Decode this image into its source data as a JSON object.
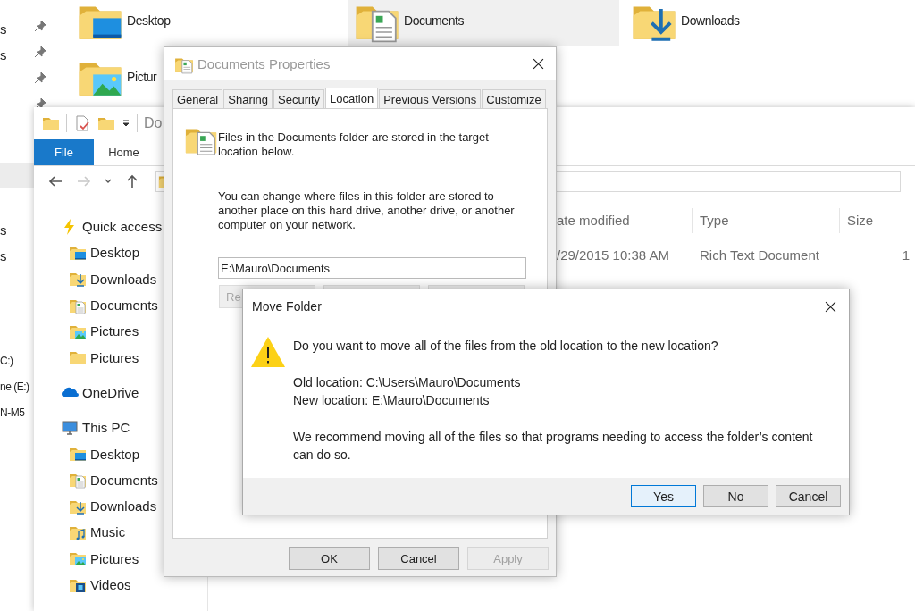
{
  "background_window": {
    "nav_groups": [
      [
        "s",
        "s"
      ],
      [
        "s",
        "s"
      ],
      [
        "C:)",
        "ne (E:)",
        "N-M5"
      ]
    ],
    "tiles": [
      {
        "label": "Desktop",
        "kind": "desktop",
        "selected": false
      },
      {
        "label": "Documents",
        "kind": "documents",
        "selected": true
      },
      {
        "label": "Downloads",
        "kind": "downloads",
        "selected": false
      },
      {
        "label": "Pictur",
        "kind": "pictures",
        "selected": false
      }
    ]
  },
  "explorer": {
    "title_fragment": "Do",
    "ribbon_tabs": [
      {
        "label": "File",
        "selected": true
      },
      {
        "label": "Home",
        "selected": false
      }
    ],
    "nav": [
      {
        "label": "Quick access",
        "kind": "quick",
        "children": [
          {
            "label": "Desktop",
            "kind": "desktop"
          },
          {
            "label": "Downloads",
            "kind": "downloads"
          },
          {
            "label": "Documents",
            "kind": "documents"
          },
          {
            "label": "Pictures",
            "kind": "pictures"
          },
          {
            "label": "Pictures",
            "kind": "folder"
          }
        ]
      },
      {
        "label": "OneDrive",
        "kind": "onedrive"
      },
      {
        "label": "This PC",
        "kind": "pc",
        "children": [
          {
            "label": "Desktop",
            "kind": "desktop"
          },
          {
            "label": "Documents",
            "kind": "documents"
          },
          {
            "label": "Downloads",
            "kind": "downloads"
          },
          {
            "label": "Music",
            "kind": "music"
          },
          {
            "label": "Pictures",
            "kind": "pictures"
          },
          {
            "label": "Videos",
            "kind": "videos"
          }
        ]
      }
    ],
    "columns": [
      "ate modified",
      "Type",
      "Size"
    ],
    "rows": [
      {
        "cells": [
          "/29/2015 10:38 AM",
          "Rich Text Document",
          "1"
        ]
      }
    ]
  },
  "properties_dialog": {
    "title": "Documents Properties",
    "tabs": [
      {
        "label": "General",
        "selected": false
      },
      {
        "label": "Sharing",
        "selected": false
      },
      {
        "label": "Security",
        "selected": false
      },
      {
        "label": "Location",
        "selected": true
      },
      {
        "label": "Previous Versions",
        "selected": false
      },
      {
        "label": "Customize",
        "selected": false
      }
    ],
    "intro": "Files in the Documents folder are stored in the target location below.",
    "explanation": "You can change where files in this folder are stored to another place on this hard drive, another drive, or another computer on your network.",
    "path_value": "E:\\Mauro\\Documents",
    "restore_button_fragment": "Re",
    "buttons": [
      {
        "label": "OK",
        "disabled": false
      },
      {
        "label": "Cancel",
        "disabled": false
      },
      {
        "label": "Apply",
        "disabled": true
      }
    ]
  },
  "move_dialog": {
    "title": "Move Folder",
    "question": "Do you want to move all of the files from the old location to the new location?",
    "old_location": "Old location: C:\\Users\\Mauro\\Documents",
    "new_location": "New location: E:\\Mauro\\Documents",
    "recommendation": "We recommend moving all of the files so that programs needing to access the folder’s content can do so.",
    "buttons": [
      {
        "label": "Yes",
        "focused": true
      },
      {
        "label": "No",
        "focused": false
      },
      {
        "label": "Cancel",
        "focused": false
      }
    ]
  }
}
